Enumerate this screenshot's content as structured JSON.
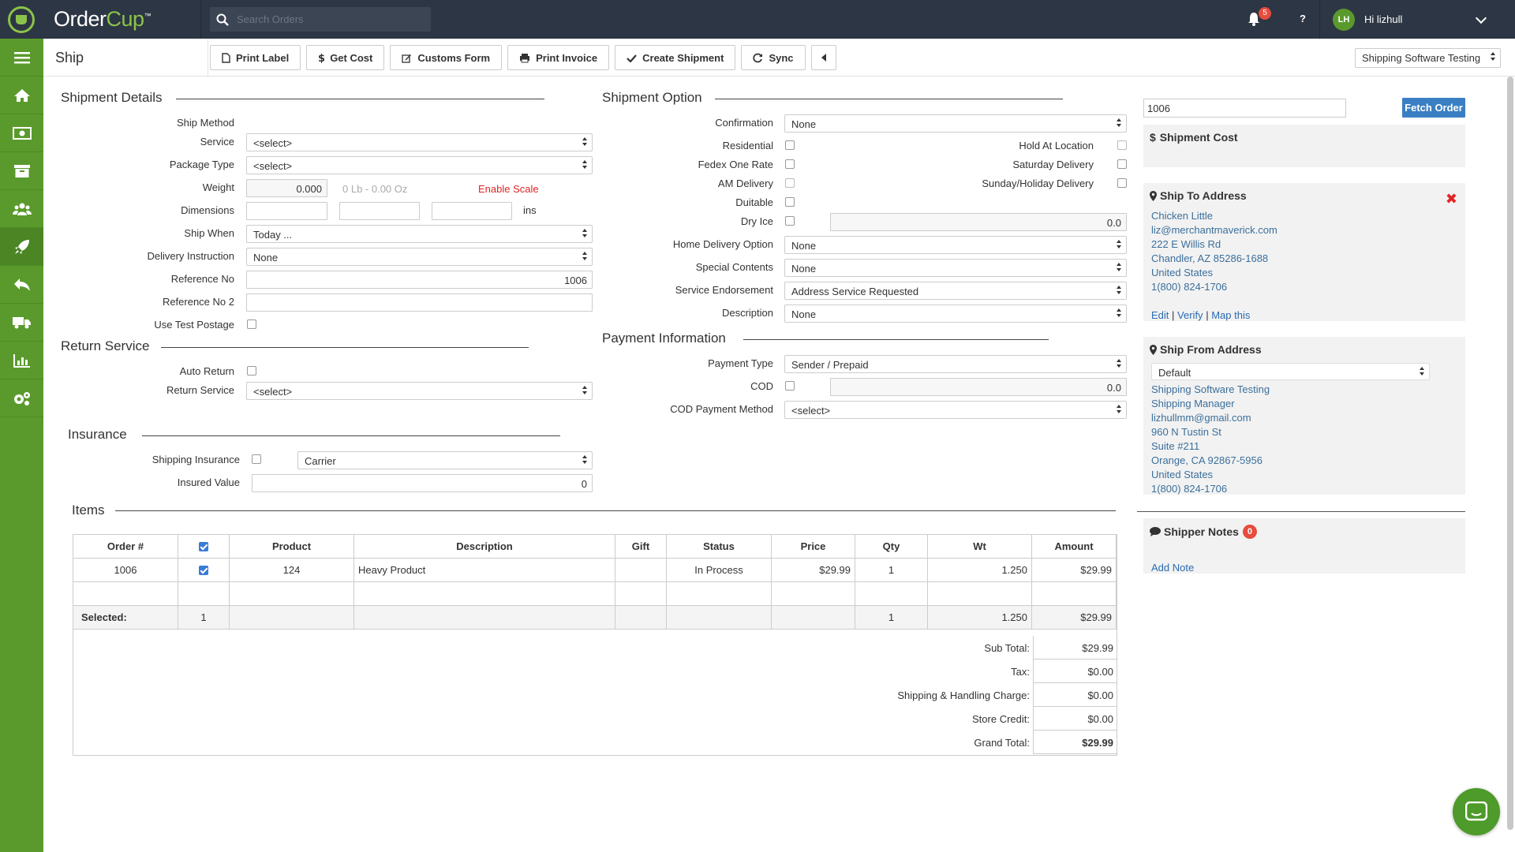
{
  "app": {
    "brand_order": "Order",
    "brand_cup": "Cup",
    "tm": "™"
  },
  "header": {
    "search_placeholder": "Search Orders",
    "notifications_count": "5",
    "help": "?",
    "user_initials": "LH",
    "user_greeting": "Hi lizhull"
  },
  "page": {
    "title": "Ship",
    "store": "Shipping Software Testing"
  },
  "toolbar": {
    "print_label": "Print Label",
    "get_cost": "Get Cost",
    "customs_form": "Customs Form",
    "print_invoice": "Print Invoice",
    "create_shipment": "Create Shipment",
    "sync": "Sync"
  },
  "shipment_details": {
    "title": "Shipment Details",
    "ship_method_label": "Ship Method",
    "service_label": "Service",
    "service_value": "<select>",
    "package_type_label": "Package Type",
    "package_type_value": "<select>",
    "weight_label": "Weight",
    "weight_value": "0.000",
    "weight_hint": "0 Lb - 0.00 Oz",
    "enable_scale": "Enable Scale",
    "dimensions_label": "Dimensions",
    "dimensions_unit": "ins",
    "ship_when_label": "Ship When",
    "ship_when_value": "Today ...",
    "delivery_instruction_label": "Delivery Instruction",
    "delivery_instruction_value": "None",
    "reference_no_label": "Reference No",
    "reference_no_value": "1006",
    "reference_no2_label": "Reference No 2",
    "use_test_postage_label": "Use Test Postage"
  },
  "return_service": {
    "title": "Return Service",
    "auto_return_label": "Auto Return",
    "return_service_label": "Return Service",
    "return_service_value": "<select>"
  },
  "insurance": {
    "title": "Insurance",
    "shipping_insurance_label": "Shipping Insurance",
    "shipping_insurance_value": "Carrier",
    "insured_value_label": "Insured Value",
    "insured_value": "0"
  },
  "shipment_option": {
    "title": "Shipment Option",
    "confirmation_label": "Confirmation",
    "confirmation_value": "None",
    "residential_label": "Residential",
    "hold_at_location_label": "Hold At Location",
    "fedex_one_rate_label": "Fedex One Rate",
    "saturday_delivery_label": "Saturday Delivery",
    "am_delivery_label": "AM Delivery",
    "sunday_holiday_label": "Sunday/Holiday Delivery",
    "duitable_label": "Duitable",
    "dry_ice_label": "Dry Ice",
    "dry_ice_value": "0.0",
    "home_delivery_label": "Home Delivery Option",
    "home_delivery_value": "None",
    "special_contents_label": "Special Contents",
    "special_contents_value": "None",
    "service_endorsement_label": "Service Endorsement",
    "service_endorsement_value": "Address Service Requested",
    "description_label": "Description",
    "description_value": "None"
  },
  "payment": {
    "title": "Payment Information",
    "payment_type_label": "Payment Type",
    "payment_type_value": "Sender / Prepaid",
    "cod_label": "COD",
    "cod_value": "0.0",
    "cod_method_label": "COD Payment Method",
    "cod_method_value": "<select>"
  },
  "right": {
    "order_no": "1006",
    "fetch_order": "Fetch Order",
    "shipment_cost_title": "Shipment Cost",
    "ship_to_title": "Ship To Address",
    "ship_to": {
      "name": "Chicken Little",
      "email": "liz@merchantmaverick.com",
      "street": "222 E Willis Rd",
      "city": "Chandler, AZ 85286-1688",
      "country": "United States",
      "phone": "1(800) 824-1706"
    },
    "edit": "Edit",
    "verify": "Verify",
    "map_this": "Map this",
    "sep": "|",
    "ship_from_title": "Ship From Address",
    "ship_from_select": "Default",
    "ship_from": {
      "company": "Shipping Software Testing",
      "title": "Shipping Manager",
      "email": "lizhullmm@gmail.com",
      "street": "960 N Tustin St",
      "suite": "Suite #211",
      "city": "Orange, CA 92867-5956",
      "country": "United States",
      "phone": "1(800) 824-1706"
    },
    "shipper_notes_title": "Shipper Notes",
    "shipper_notes_count": "0",
    "add_note": "Add Note"
  },
  "items": {
    "title": "Items",
    "columns": [
      "Order #",
      "",
      "Product",
      "Description",
      "Gift",
      "Status",
      "Price",
      "Qty",
      "Wt",
      "Amount"
    ],
    "rows": [
      {
        "order": "1006",
        "product": "124",
        "description": "Heavy Product",
        "gift": "",
        "status": "In Process",
        "price": "$29.99",
        "qty": "1",
        "wt": "1.250",
        "amount": "$29.99"
      }
    ],
    "selected_label": "Selected:",
    "selected_count": "1",
    "selected_qty": "1",
    "selected_wt": "1.250",
    "selected_amount": "$29.99",
    "totals": [
      {
        "label": "Sub Total:",
        "value": "$29.99"
      },
      {
        "label": "Tax:",
        "value": "$0.00"
      },
      {
        "label": "Shipping & Handling Charge:",
        "value": "$0.00"
      },
      {
        "label": "Store Credit:",
        "value": "$0.00"
      },
      {
        "label": "Grand Total:",
        "value": "$29.99"
      }
    ]
  },
  "colors": {
    "sidebar": "#5a9a2c",
    "topbar": "#2d3644",
    "accent_blue": "#3a7fc4",
    "danger": "#e02424"
  }
}
